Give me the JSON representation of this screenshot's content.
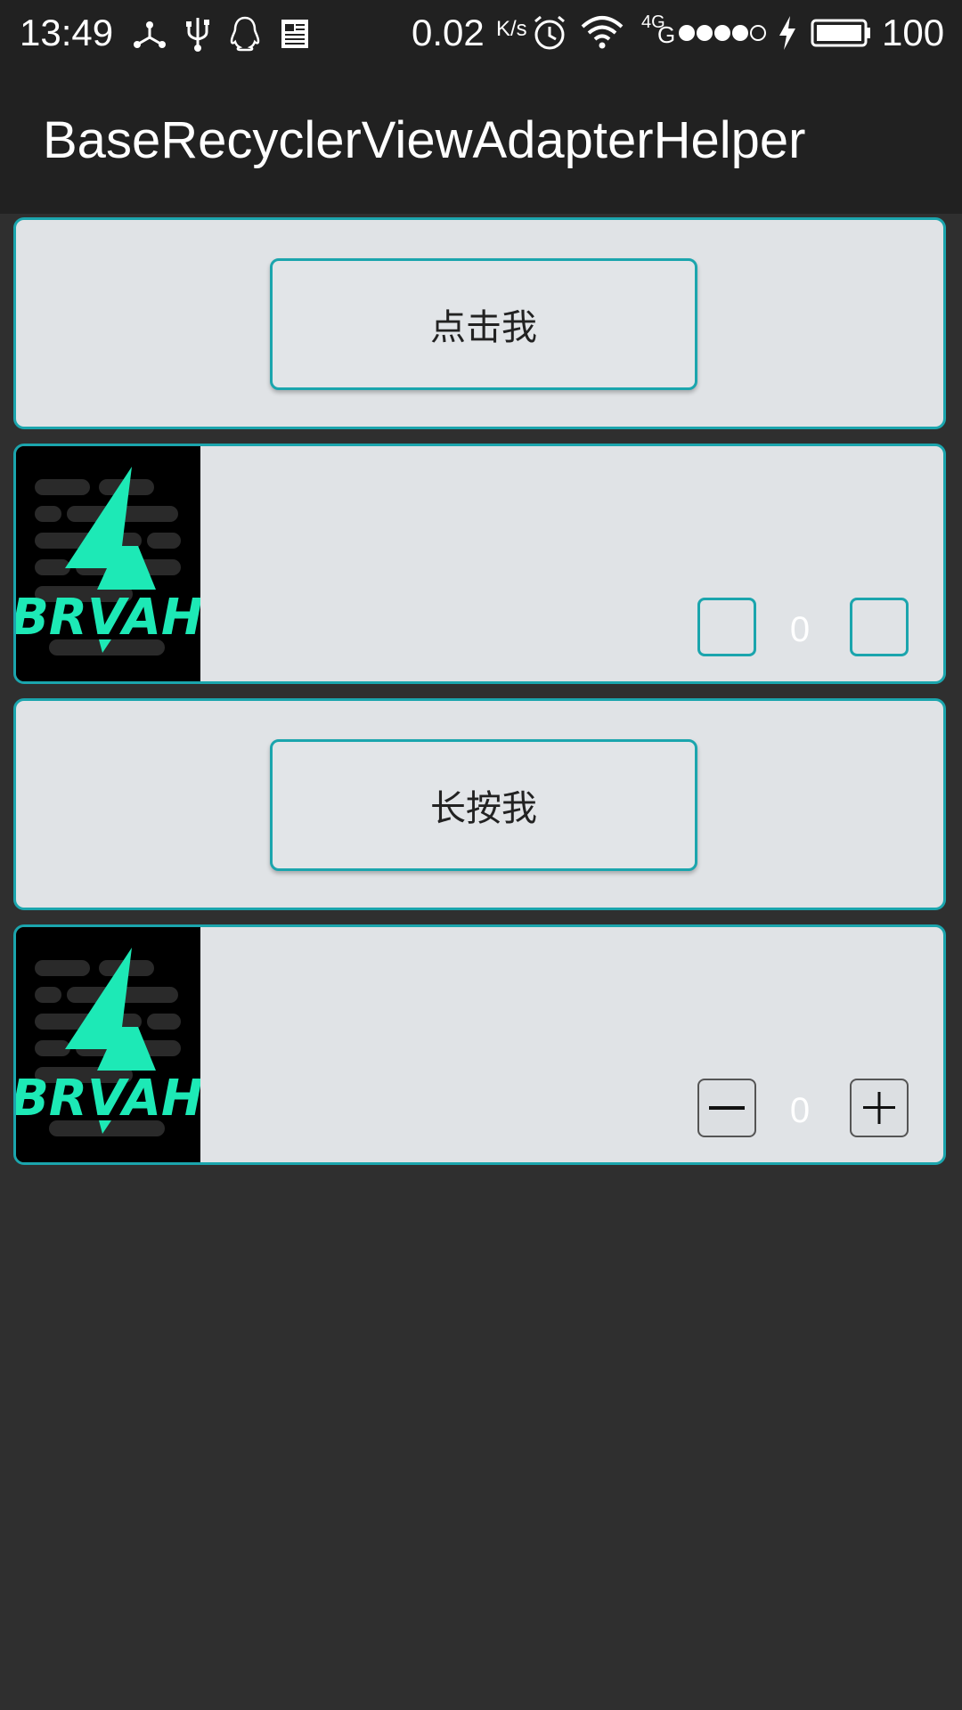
{
  "status_bar": {
    "time": "13:49",
    "network_speed": "0.02",
    "network_speed_unit": "K/s",
    "network_type": "4G",
    "battery_percent": "100",
    "icons": [
      "share-icon",
      "usb-icon",
      "qq-icon",
      "news-icon",
      "alarm-icon",
      "wifi-icon",
      "signal-icon",
      "charging-icon",
      "battery-icon"
    ]
  },
  "toolbar": {
    "title": "BaseRecyclerViewAdapterHelper"
  },
  "list": {
    "items": [
      {
        "type": "button",
        "label": "点击我"
      },
      {
        "type": "counter",
        "logo_text": "BRVAH",
        "count": "0"
      },
      {
        "type": "button",
        "label": "长按我"
      },
      {
        "type": "counter",
        "logo_text": "BRVAH",
        "count": "0"
      }
    ]
  },
  "colors": {
    "accent": "#1ba5ad",
    "background": "#2f2f2f",
    "toolbar": "#212121",
    "card": "#e0e3e6",
    "logo_green": "#1de9b6"
  }
}
